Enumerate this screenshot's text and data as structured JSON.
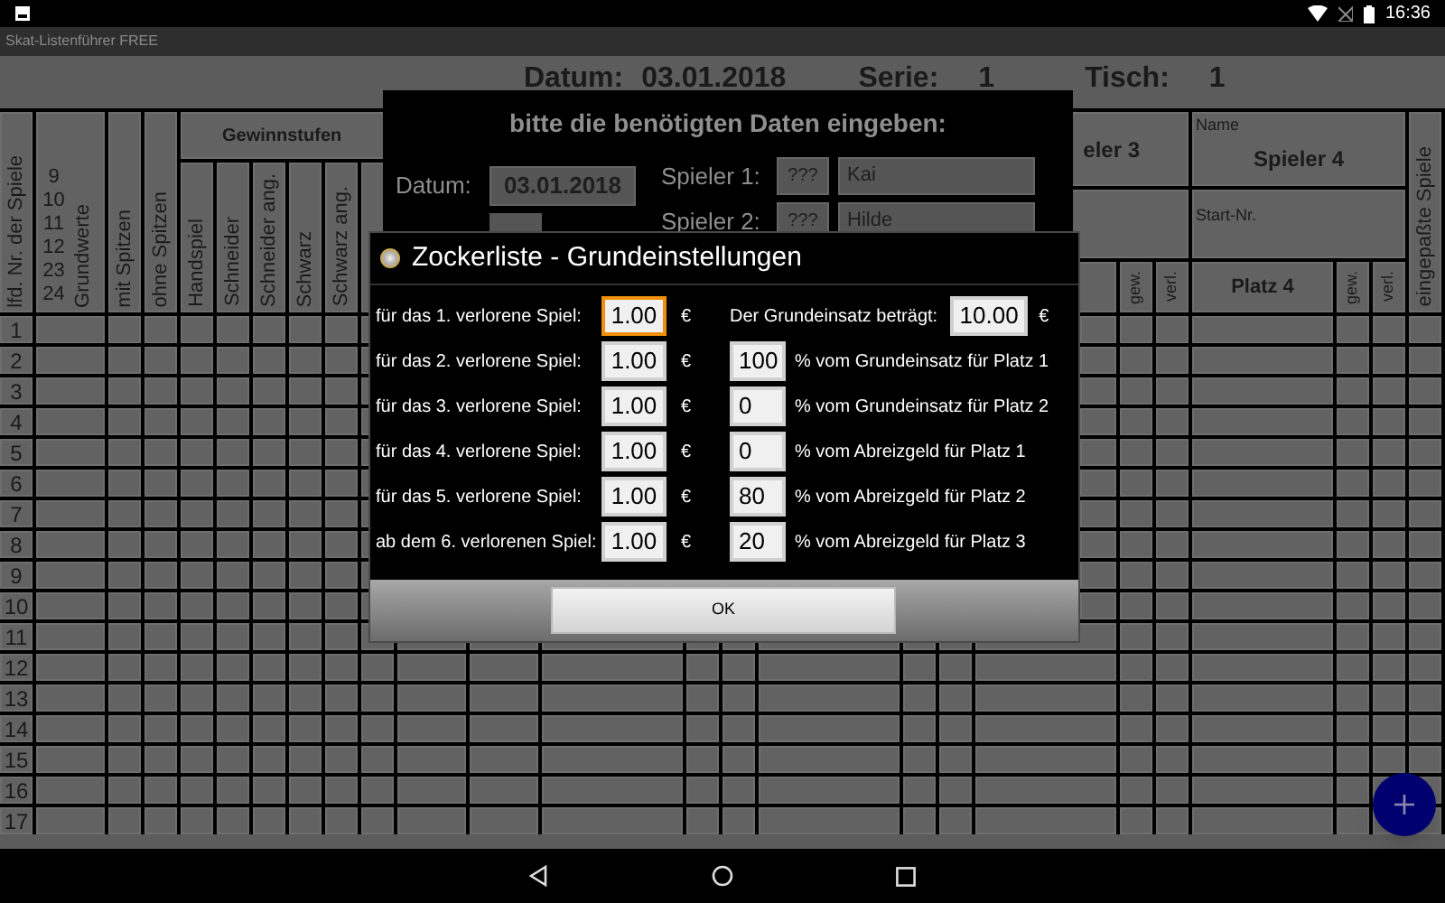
{
  "status_bar": {
    "time": "16:36"
  },
  "app_bar": {
    "title": "Skat-Listenführer FREE"
  },
  "sheet_header": {
    "date_label": "Datum:",
    "date": "03.01.2018",
    "series_label": "Serie:",
    "series": "1",
    "table_label": "Tisch:",
    "table": "1"
  },
  "table": {
    "number_header": "lfd. Nr. der Spiele",
    "base_values": [
      "9",
      "10",
      "11",
      "12",
      "23",
      "24"
    ],
    "base_values_label": "Grundwerte",
    "with_tops": "mit Spitzen",
    "without_tops": "ohne Spitzen",
    "levels_header": "Gewinnstufen",
    "levels": [
      "Handspiel",
      "Schneider",
      "Schneider ang.",
      "Schwarz",
      "Schwarz ang."
    ],
    "player_3": {
      "name": "eler 3",
      "won": "gew.",
      "lost": "verl."
    },
    "player_4": {
      "name_label": "Name",
      "name": "Spieler 4",
      "start_label": "Start-Nr.",
      "place": "Platz 4",
      "won": "gew.",
      "lost": "verl."
    },
    "fitted_games": "eingepaßte Spiele",
    "rows": [
      "1",
      "2",
      "3",
      "4",
      "5",
      "6",
      "7",
      "8",
      "9",
      "10",
      "11",
      "12",
      "13",
      "14",
      "15",
      "16",
      "17"
    ]
  },
  "data_dialog": {
    "title": "bitte die benötigten Daten eingeben:",
    "date_label": "Datum:",
    "date": "03.01.2018",
    "players": [
      {
        "label": "Spieler 1:",
        "number": "???",
        "name": "Kai"
      },
      {
        "label": "Spieler 2:",
        "number": "???",
        "name": "Hilde"
      }
    ]
  },
  "settings_dialog": {
    "title": "Zockerliste - Grundeinstellungen",
    "rows": [
      {
        "label": "für das 1. verlorene Spiel:",
        "value": "1.00",
        "focused": true,
        "currency": "€",
        "kind": "stake",
        "right_label": "Der Grundeinsatz beträgt:",
        "right_value": "10.00",
        "right_currency": "€"
      },
      {
        "label": "für das 2. verlorene Spiel:",
        "value": "1.00",
        "focused": false,
        "currency": "€",
        "kind": "percent",
        "right_value": "100",
        "right_label": "% vom Grundeinsatz für Platz 1"
      },
      {
        "label": "für das 3. verlorene Spiel:",
        "value": "1.00",
        "focused": false,
        "currency": "€",
        "kind": "percent",
        "right_value": "0",
        "right_label": "% vom Grundeinsatz für Platz 2"
      },
      {
        "label": "für das 4. verlorene Spiel:",
        "value": "1.00",
        "focused": false,
        "currency": "€",
        "kind": "percent",
        "right_value": "0",
        "right_label": "% vom Abreizgeld für Platz 1"
      },
      {
        "label": "für das 5. verlorene Spiel:",
        "value": "1.00",
        "focused": false,
        "currency": "€",
        "kind": "percent",
        "right_value": "80",
        "right_label": "% vom Abreizgeld für Platz 2"
      },
      {
        "label": "ab dem 6. verlorenen Spiel:",
        "value": "1.00",
        "focused": false,
        "currency": "€",
        "kind": "percent",
        "right_value": "20",
        "right_label": "% vom Abreizgeld für Platz 3"
      }
    ],
    "ok": "OK"
  }
}
